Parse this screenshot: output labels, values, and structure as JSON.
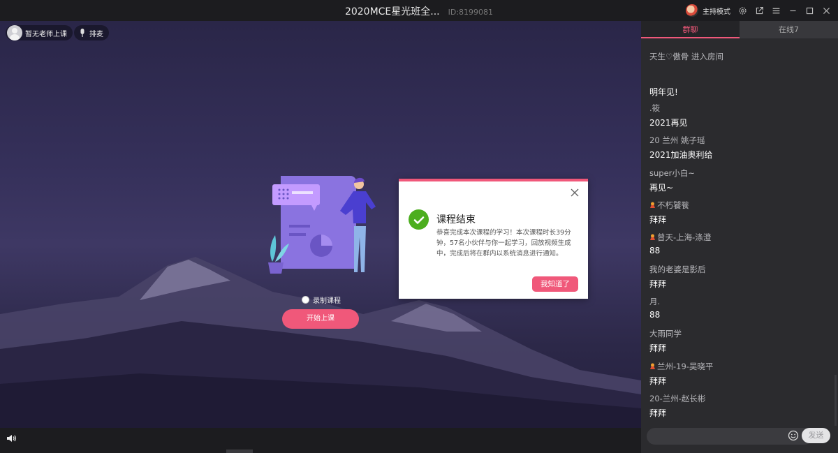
{
  "window": {
    "title": "2020MCE星光班全...",
    "id_label": "ID:8199081",
    "host_mode_label": "主持模式"
  },
  "stage": {
    "teacher_label": "暂无老师上课",
    "mic_queue_label": "排麦",
    "record_label": "录制课程",
    "start_button_label": "开始上课"
  },
  "dialog": {
    "title": "课程结束",
    "body": "恭喜完成本次课程的学习！本次课程时长39分钟，57名小伙伴与你一起学习，回放视频生成中，完成后将在群内以系统消息进行通知。",
    "confirm_label": "我知道了"
  },
  "sidebar": {
    "tabs": [
      {
        "label": "群聊",
        "active": true
      },
      {
        "label": "在线7",
        "active": false
      }
    ],
    "messages": [
      {
        "name": "天生♡傲骨 进入房间",
        "text": "",
        "crown": false
      },
      {
        "name": "",
        "text": "明年见!",
        "crown": false
      },
      {
        "name": ".筱",
        "text": "2021再见",
        "crown": false
      },
      {
        "name": "20  兰州  姚子瑶",
        "text": "2021加油奥利给",
        "crown": false
      },
      {
        "name": "super小白~",
        "text": "再见~",
        "crown": false
      },
      {
        "name": "不朽饕餮",
        "text": "拜拜",
        "crown": true
      },
      {
        "name": "曾天-上海-涤澄",
        "text": "88",
        "crown": true
      },
      {
        "name": "我的老婆是影后",
        "text": "拜拜",
        "crown": false
      },
      {
        "name": "月.",
        "text": "88",
        "crown": false
      },
      {
        "name": "大雨同学",
        "text": "拜拜",
        "crown": false
      },
      {
        "name": "兰州-19-吴晓平",
        "text": "拜拜",
        "crown": true
      },
      {
        "name": "20-兰州-赵长彬",
        "text": "拜拜",
        "crown": false
      }
    ],
    "send_label": "发送"
  },
  "colors": {
    "accent": "#f0587a",
    "success": "#4cae1f"
  }
}
